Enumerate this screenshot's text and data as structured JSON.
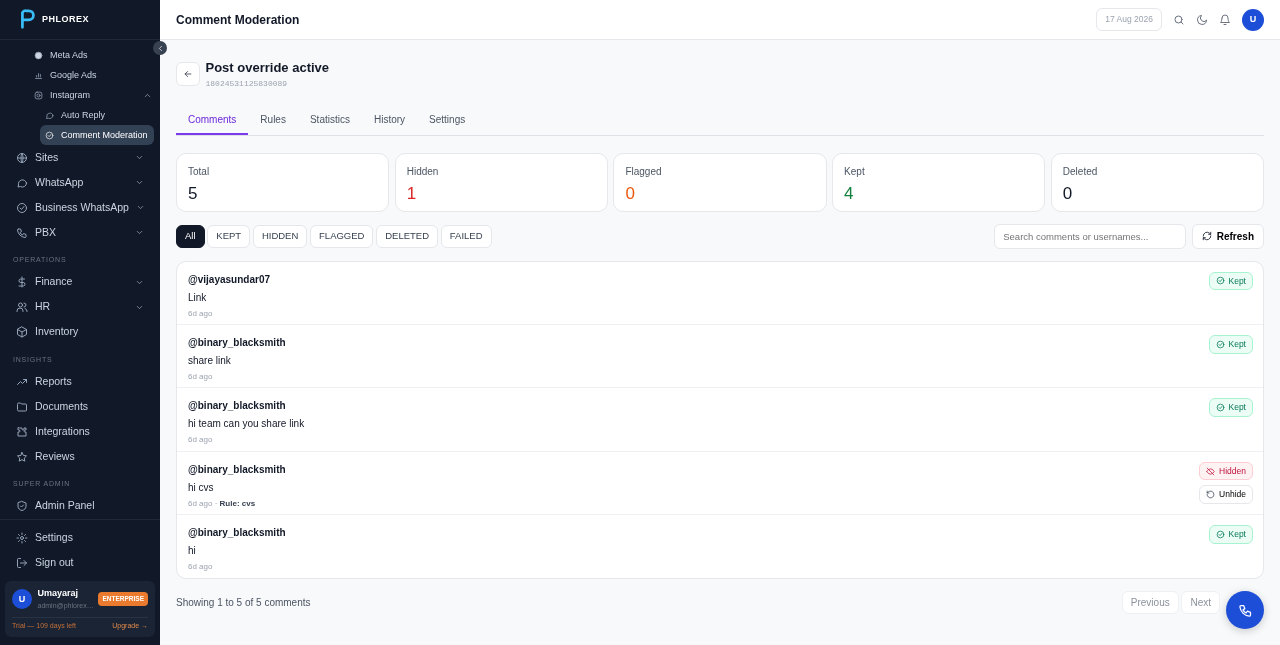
{
  "sidebar": {
    "logo": "PHLOREX",
    "items": [
      {
        "label": "Meta Ads",
        "kind": "sub",
        "selected": false
      },
      {
        "label": "Google Ads",
        "kind": "sub",
        "selected": false
      },
      {
        "label": "Instagram",
        "kind": "sub",
        "selected": false,
        "expanded": true,
        "children": [
          {
            "label": "Auto Reply",
            "selected": false
          },
          {
            "label": "Comment Moderation",
            "selected": true
          }
        ]
      },
      {
        "label": "Sites",
        "kind": "group",
        "selected": false,
        "expanded": false
      },
      {
        "label": "WhatsApp",
        "kind": "group",
        "selected": false,
        "expanded": false
      },
      {
        "label": "Business WhatsApp",
        "kind": "group",
        "selected": false,
        "expanded": false
      },
      {
        "label": "PBX",
        "kind": "group",
        "selected": false,
        "expanded": false
      },
      {
        "label": "OPERATIONS",
        "kind": "heading"
      },
      {
        "label": "Finance",
        "kind": "group",
        "selected": false,
        "expanded": false
      },
      {
        "label": "HR",
        "kind": "group",
        "selected": false,
        "expanded": false
      },
      {
        "label": "Inventory",
        "kind": "link",
        "selected": false
      },
      {
        "label": "INSIGHTS",
        "kind": "heading"
      },
      {
        "label": "Reports",
        "kind": "link",
        "selected": false
      },
      {
        "label": "Documents",
        "kind": "link",
        "selected": false
      },
      {
        "label": "Integrations",
        "kind": "link",
        "selected": false
      },
      {
        "label": "Reviews",
        "kind": "link",
        "selected": false
      },
      {
        "label": "SUPER ADMIN",
        "kind": "heading"
      },
      {
        "label": "Admin Panel",
        "kind": "link",
        "selected": false
      }
    ],
    "bottom": [
      {
        "label": "Settings"
      },
      {
        "label": "Sign out"
      }
    ],
    "user": {
      "initial": "U",
      "name": "Umayaraj",
      "email": "admin@phlorex…",
      "plan": "ENTERPRISE",
      "trial": "Trial — 109 days left",
      "upgrade": "Upgrade →"
    }
  },
  "header": {
    "title": "Comment Moderation",
    "date": "17 Aug 2026",
    "avatar": "U"
  },
  "post": {
    "title": "Post override active",
    "id": "18024531125830089"
  },
  "tabs": [
    {
      "label": "Comments",
      "selected": true
    },
    {
      "label": "Rules",
      "selected": false
    },
    {
      "label": "Statistics",
      "selected": false
    },
    {
      "label": "History",
      "selected": false
    },
    {
      "label": "Settings",
      "selected": false
    }
  ],
  "stats": [
    {
      "label": "Total",
      "value": "5",
      "color": "#111827"
    },
    {
      "label": "Hidden",
      "value": "1",
      "color": "#dc2626"
    },
    {
      "label": "Flagged",
      "value": "0",
      "color": "#ea580c"
    },
    {
      "label": "Kept",
      "value": "4",
      "color": "#15803d"
    },
    {
      "label": "Deleted",
      "value": "0",
      "color": "#111827"
    }
  ],
  "filters": [
    {
      "label": "All",
      "selected": true
    },
    {
      "label": "KEPT",
      "selected": false
    },
    {
      "label": "HIDDEN",
      "selected": false
    },
    {
      "label": "FLAGGED",
      "selected": false
    },
    {
      "label": "DELETED",
      "selected": false
    },
    {
      "label": "FAILED",
      "selected": false
    }
  ],
  "search": {
    "placeholder": "Search comments or usernames..."
  },
  "refresh": "Refresh",
  "comments": [
    {
      "user": "@vijayasundar07",
      "text": "Link",
      "time": "6d ago",
      "kind": "kept",
      "status_label": "Kept"
    },
    {
      "user": "@binary_blacksmith",
      "text": "share link",
      "time": "6d ago",
      "kind": "kept",
      "status_label": "Kept"
    },
    {
      "user": "@binary_blacksmith",
      "text": "hi team can you share link",
      "time": "6d ago",
      "kind": "kept",
      "status_label": "Kept"
    },
    {
      "user": "@binary_blacksmith",
      "text": "hi cvs",
      "time": "6d ago · ",
      "rule": "Rule: cvs",
      "kind": "hidden",
      "status_label": "Hidden",
      "action": "Unhide"
    },
    {
      "user": "@binary_blacksmith",
      "text": "hi",
      "time": "6d ago",
      "kind": "kept",
      "status_label": "Kept"
    }
  ],
  "pagination": {
    "summary": "Showing 1 to 5 of 5 comments",
    "previous": {
      "label": "Previous",
      "disabled": true
    },
    "next": {
      "label": "Next",
      "disabled": true
    }
  }
}
